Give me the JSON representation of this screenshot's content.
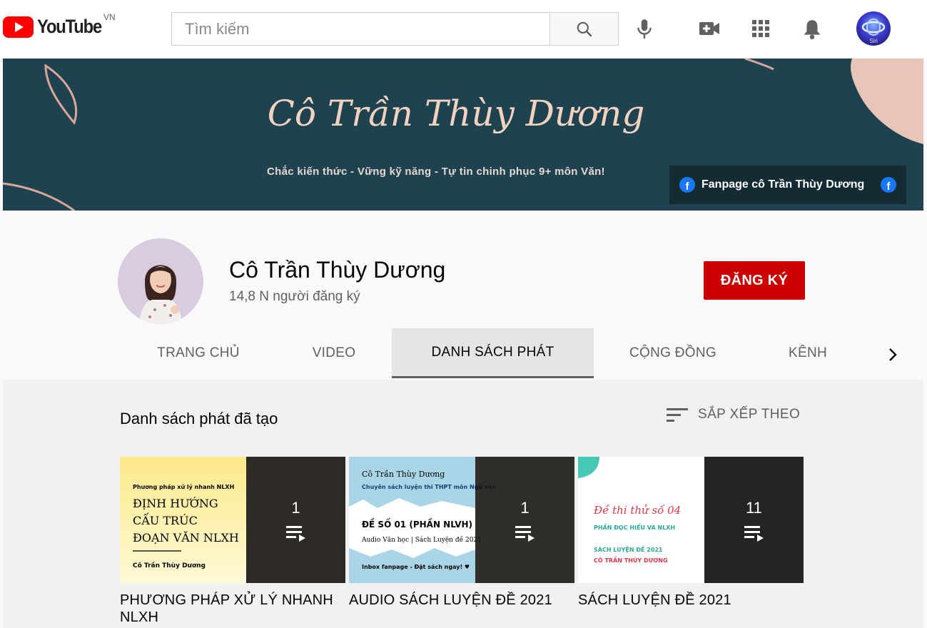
{
  "topbar": {
    "logo_text": "YouTube",
    "country": "VN",
    "search_placeholder": "Tìm kiếm",
    "avatar_label": "Siri"
  },
  "banner": {
    "title": "Cô Trần Thùy Dương",
    "tagline": "Chắc kiến thức - Vững kỹ năng - Tự tin chinh phục 9+ môn Văn!",
    "fanpage_label": "Fanpage cô Trần Thùy Dương"
  },
  "channel": {
    "name": "Cô Trần Thùy Dương",
    "subscribers": "14,8 N người đăng ký",
    "subscribe_label": "ĐĂNG KÝ"
  },
  "tabs": [
    {
      "label": "TRANG CHỦ",
      "active": false
    },
    {
      "label": "VIDEO",
      "active": false
    },
    {
      "label": "DANH SÁCH PHÁT",
      "active": true
    },
    {
      "label": "CỘNG ĐỒNG",
      "active": false
    },
    {
      "label": "KÊNH",
      "active": false
    }
  ],
  "content": {
    "section_title": "Danh sách phát đã tạo",
    "sort_label": "SẮP XẾP THEO"
  },
  "playlists": [
    {
      "title": "PHƯƠNG PHÁP XỬ LÝ NHANH NLXH",
      "count": "1",
      "thumb": {
        "lines": [
          "Phương pháp xử lý nhanh NLXH",
          "ĐỊNH HƯỚNG",
          "CẤU TRÚC",
          "ĐOẠN VĂN NLXH",
          "Cô Trần Thùy Dương"
        ]
      }
    },
    {
      "title": "AUDIO SÁCH LUYỆN ĐỀ 2021",
      "count": "1",
      "thumb": {
        "lines": [
          "Cô Trần Thùy Dương",
          "Chuyên sách luyện thi THPT môn Ngữ văn",
          "ĐỀ SỐ 01 (PHẦN NLVH)",
          "Audio Văn học | Sách Luyện đề 2021",
          "Inbox fanpage - Đặt sách ngay! ♥"
        ]
      }
    },
    {
      "title": "SÁCH LUYỆN ĐỀ 2021",
      "count": "11",
      "thumb": {
        "lines": [
          "Đề thi thử số 04",
          "PHẦN ĐỌC HIỂU VÀ NLXH",
          "SÁCH LUYỆN ĐỀ 2021",
          "CÔ TRẦN THÙY DƯƠNG"
        ]
      }
    }
  ],
  "colors": {
    "brand_red": "#ff0000",
    "subscribe_red": "#cc0000",
    "banner_bg": "#1f4250",
    "banner_text": "#f0d2bf"
  }
}
